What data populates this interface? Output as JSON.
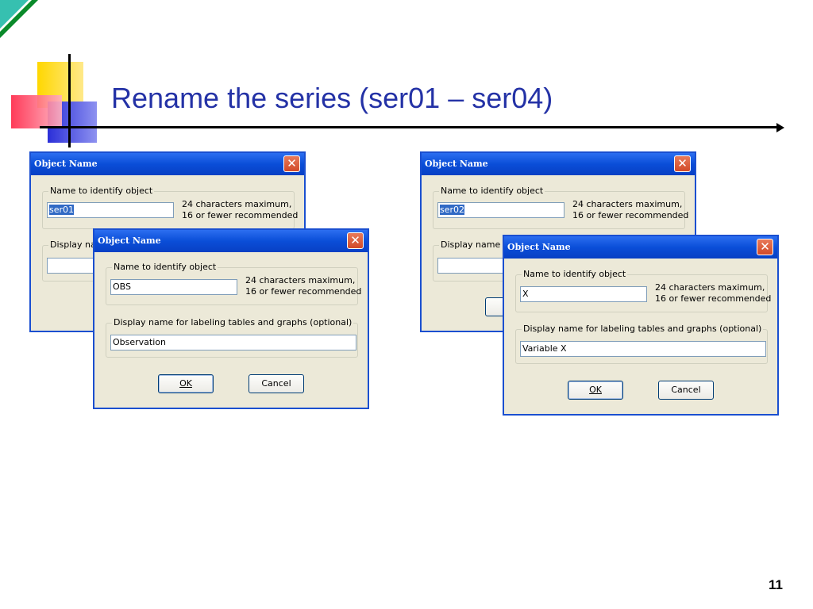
{
  "slide": {
    "title": "Rename the series (ser01 – ser04)",
    "page_number": "11"
  },
  "colors": {
    "title": "#2432a6",
    "titlebar": "#0a4ed8",
    "dialog_bg": "#ece9d8",
    "close_button": "#d24a28",
    "selection": "#316ac5"
  },
  "left_back": {
    "title": "Object Name",
    "name_legend": "Name to identify object",
    "name_value": "ser01",
    "note_line1": "24 characters maximum,",
    "note_line2": "16 or fewer recommended",
    "display_legend": "Display nan"
  },
  "left_front": {
    "title": "Object Name",
    "name_legend": "Name to identify object",
    "name_value": "OBS",
    "note_line1": "24 characters maximum,",
    "note_line2": "16 or fewer recommended",
    "display_legend": "Display name for labeling tables and graphs  (optional)",
    "display_value": "Observation",
    "ok_label": "OK",
    "cancel_label": "Cancel"
  },
  "right_back": {
    "title": "Object Name",
    "name_legend": "Name to identify object",
    "name_value": "ser02",
    "note_line1": "24 characters maximum,",
    "note_line2": "16 or fewer recommended",
    "display_legend": "Display name fo"
  },
  "right_front": {
    "title": "Object Name",
    "name_legend": "Name to identify object",
    "name_value": "X",
    "note_line1": "24 characters maximum,",
    "note_line2": "16 or fewer recommended",
    "display_legend": "Display name for labeling tables and graphs  (optional)",
    "display_value": "Variable X",
    "ok_label": "OK",
    "cancel_label": "Cancel"
  }
}
